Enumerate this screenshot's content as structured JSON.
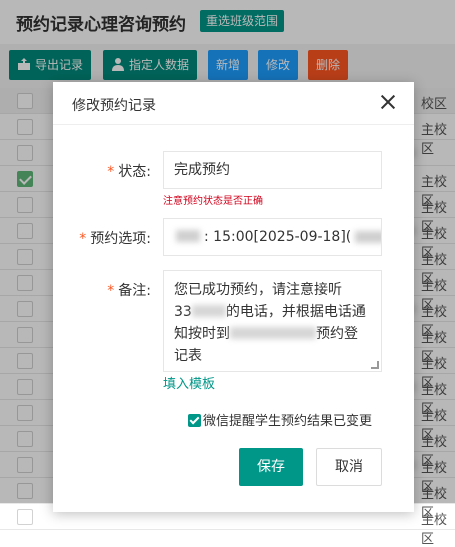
{
  "page": {
    "title": "预约记录心理咨询预约",
    "scope_button": "重选班级范围"
  },
  "toolbar": {
    "export_label": "导出记录",
    "assign_label": "指定人数据",
    "new_label": "新增",
    "edit_label": "修改",
    "delete_label": "删除"
  },
  "table": {
    "campus_header": "校区",
    "rows": [
      {
        "campus": "主校区",
        "checked": false
      },
      {
        "campus": "",
        "checked": false
      },
      {
        "campus": "主校区",
        "checked": true
      },
      {
        "campus": "主校区",
        "checked": false
      },
      {
        "campus": "主校区",
        "checked": false
      },
      {
        "campus": "主校区",
        "checked": false
      },
      {
        "campus": "主校区",
        "checked": false
      },
      {
        "campus": "主校区",
        "checked": false
      },
      {
        "campus": "主校区",
        "checked": false
      },
      {
        "campus": "主校区",
        "checked": false
      },
      {
        "campus": "主校区",
        "checked": false
      },
      {
        "campus": "主校区",
        "checked": false
      },
      {
        "campus": "主校区",
        "checked": false
      },
      {
        "campus": "主校区",
        "checked": false
      },
      {
        "campus": "主校区",
        "checked": false
      },
      {
        "campus": "主校区",
        "checked": false
      }
    ]
  },
  "modal": {
    "title": "修改预约记录",
    "status_label": "状态:",
    "status_value": "完成预约",
    "status_hint": "注意预约状态是否正确",
    "option_label": "预约选项:",
    "option_value": ": 15:00[2025-09-18](",
    "remark_label": "备注:",
    "remark_line1": "您已成功预约，请注意接听",
    "remark_line2_a": "33",
    "remark_line2_b": "的电话，并根据电话通",
    "remark_line3_a": "知按时到",
    "remark_line3_b": "预约登",
    "remark_line4": "记表",
    "fill_template": "填入模板",
    "wechat_notify": "微信提醒学生预约结果已变更",
    "save_label": "保存",
    "cancel_label": "取消",
    "required_mark": "*"
  },
  "colors": {
    "primary_teal": "#009688",
    "blue": "#1e9fff",
    "danger": "#ff5722",
    "hint_red": "#d0021b",
    "check_green": "#5fb878"
  }
}
